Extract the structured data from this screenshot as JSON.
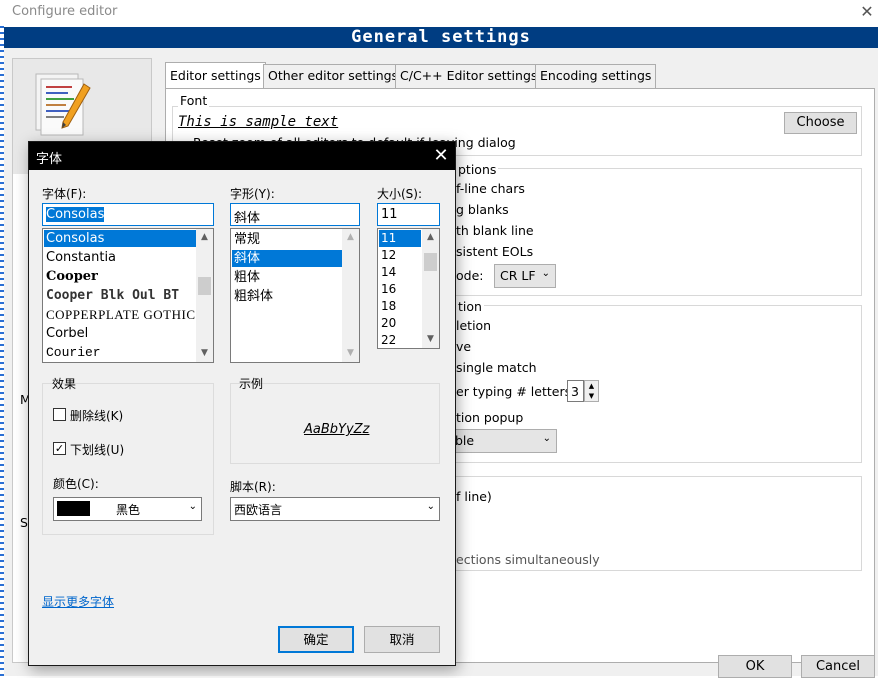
{
  "window": {
    "title": "Configure editor",
    "close_glyph": "✕"
  },
  "banner": {
    "title": "General settings"
  },
  "left_pane": {
    "label_m": "M",
    "label_s": "Sy"
  },
  "tabs": [
    {
      "label": "Editor settings",
      "active": true
    },
    {
      "label": "Other editor settings",
      "active": false
    },
    {
      "label": "C/C++ Editor settings",
      "active": false
    },
    {
      "label": "Encoding settings",
      "active": false
    }
  ],
  "editor": {
    "font_group": "Font",
    "sample_text": "This is sample text",
    "choose_label": "Choose",
    "reset_zoom_partial": "Reset zoom of all editors to default if leaving dialog",
    "other_options_partial": "ptions",
    "eol_chars_partial": "f-line chars",
    "blanks_partial": "g blanks",
    "blank_line_partial": "th blank line",
    "consistent_eols_partial": "sistent EOLs",
    "eol_mode_partial": "ode:",
    "eol_mode_value": "CR LF",
    "completion_group_partial": "tion",
    "completion_partial": "letion",
    "case_partial": "ve",
    "single_match_partial": "single match",
    "after_typing_partial": "er typing # letters:",
    "letters_value": "3",
    "popup_partial": "tion popup",
    "popup_value_partial": "ble",
    "end_of_line_partial": "f line)",
    "selections_partial": "ections simultaneously"
  },
  "buttons": {
    "ok": "OK",
    "cancel": "Cancel"
  },
  "font_dialog": {
    "title": "字体",
    "font_label": "字体(F):",
    "font_value": "Consolas",
    "fonts": [
      "Consolas",
      "Constantia",
      "Cooper",
      "Cooper Blk Oul BT",
      "COPPERPLATE GOTHIC",
      "Corbel",
      "Courier"
    ],
    "selected_font": "Consolas",
    "style_label": "字形(Y):",
    "style_value": "斜体",
    "styles": [
      "常规",
      "斜体",
      "粗体",
      "粗斜体"
    ],
    "selected_style": "斜体",
    "size_label": "大小(S):",
    "size_value": "11",
    "sizes": [
      "11",
      "12",
      "14",
      "16",
      "18",
      "20",
      "22"
    ],
    "selected_size": "11",
    "effects_label": "效果",
    "strikeout_label": "删除线(K)",
    "strikeout_checked": false,
    "underline_label": "下划线(U)",
    "underline_checked": true,
    "color_label": "颜色(C):",
    "color_value": "黑色",
    "color_hex": "#000000",
    "sample_label": "示例",
    "sample_preview": "AaBbYyZz",
    "script_label": "脚本(R):",
    "script_value": "西欧语言",
    "more_fonts": "显示更多字体",
    "ok": "确定",
    "cancel": "取消"
  },
  "colors": {
    "banner": "#003d82",
    "accent": "#0078d7"
  }
}
